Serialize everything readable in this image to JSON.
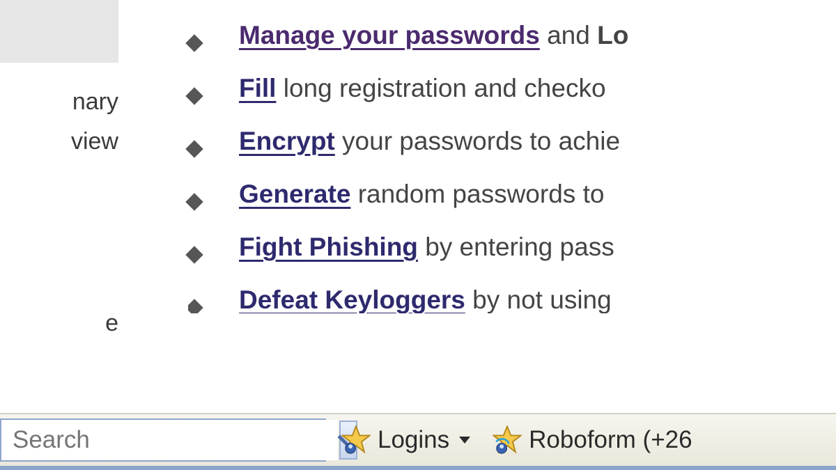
{
  "sidebar": {
    "items": [
      {
        "label_1": "",
        "label_2": ""
      },
      {
        "label_1": "nary",
        "label_2": "view"
      },
      {
        "label_1": "",
        "label_2": ""
      },
      {
        "label_1": "e",
        "label_2": ""
      }
    ]
  },
  "features": [
    {
      "link": "Manage your passwords",
      "rest": " and ",
      "bold_tail": "Lo",
      "visited": true
    },
    {
      "link": "Fill",
      "rest": " long registration and checko",
      "bold_tail": "",
      "visited": false
    },
    {
      "link": "Encrypt",
      "rest": " your passwords to achie",
      "bold_tail": "",
      "visited": false
    },
    {
      "link": "Generate",
      "rest": " random passwords to",
      "bold_tail": "",
      "visited": false
    },
    {
      "link": "Fight Phishing",
      "rest": " by entering pass",
      "bold_tail": "",
      "visited": false
    },
    {
      "link": "Defeat Keyloggers",
      "rest": " by not using",
      "bold_tail": "",
      "visited": false
    }
  ],
  "toolbar": {
    "search_placeholder": "Search",
    "logins_label": "Logins",
    "roboform_label": "Roboform (+26"
  },
  "colors": {
    "link": "#2e2a6e",
    "visited": "#4b2a6e",
    "text": "#444444",
    "toolbar_border": "#8aa5c9"
  }
}
